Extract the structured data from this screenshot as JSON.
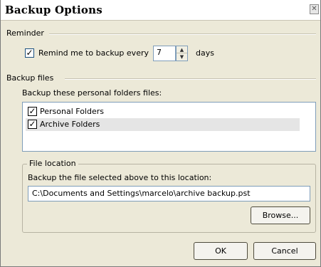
{
  "window": {
    "title": "Backup Options",
    "close_glyph": "✕"
  },
  "reminder": {
    "group_label": "Reminder",
    "checkbox_checked": true,
    "checkbox_label": "Remind me to backup every",
    "interval_value": "7",
    "interval_unit": "days"
  },
  "backup_files": {
    "group_label": "Backup files",
    "list_label": "Backup these personal folders files:",
    "items": [
      {
        "label": "Personal Folders",
        "checked": true,
        "selected": false
      },
      {
        "label": "Archive Folders",
        "checked": true,
        "selected": true
      }
    ]
  },
  "file_location": {
    "legend": "File location",
    "description": "Backup the file selected above to this location:",
    "path": "C:\\Documents and Settings\\marcelo\\archive backup.pst",
    "browse_label": "Browse..."
  },
  "footer": {
    "ok_label": "OK",
    "cancel_label": "Cancel"
  },
  "icons": {
    "check": "check-icon",
    "spin_up": "chevron-up-icon",
    "spin_down": "chevron-down-icon",
    "close": "close-icon"
  },
  "colors": {
    "dialog_bg": "#ece9d8",
    "input_border": "#7f9db9",
    "selected_row": "#e5e5e5"
  }
}
